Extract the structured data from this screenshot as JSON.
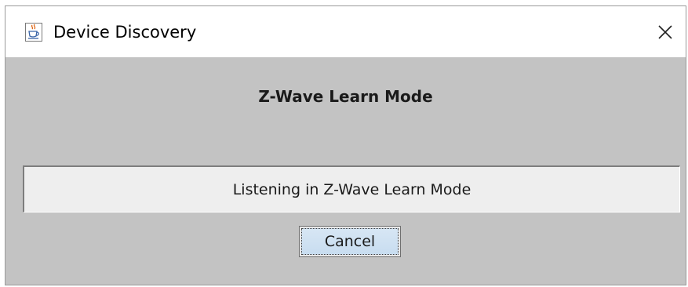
{
  "window": {
    "title": "Device Discovery",
    "icon": "java-coffee-cup-icon",
    "close_icon": "close-icon"
  },
  "dialog": {
    "heading": "Z-Wave Learn Mode",
    "status": "Listening in Z-Wave Learn Mode",
    "cancel_label": "Cancel"
  },
  "colors": {
    "dialog_background": "#c3c3c3",
    "status_background": "#eeeeee",
    "button_background": "#d0e3f5"
  }
}
